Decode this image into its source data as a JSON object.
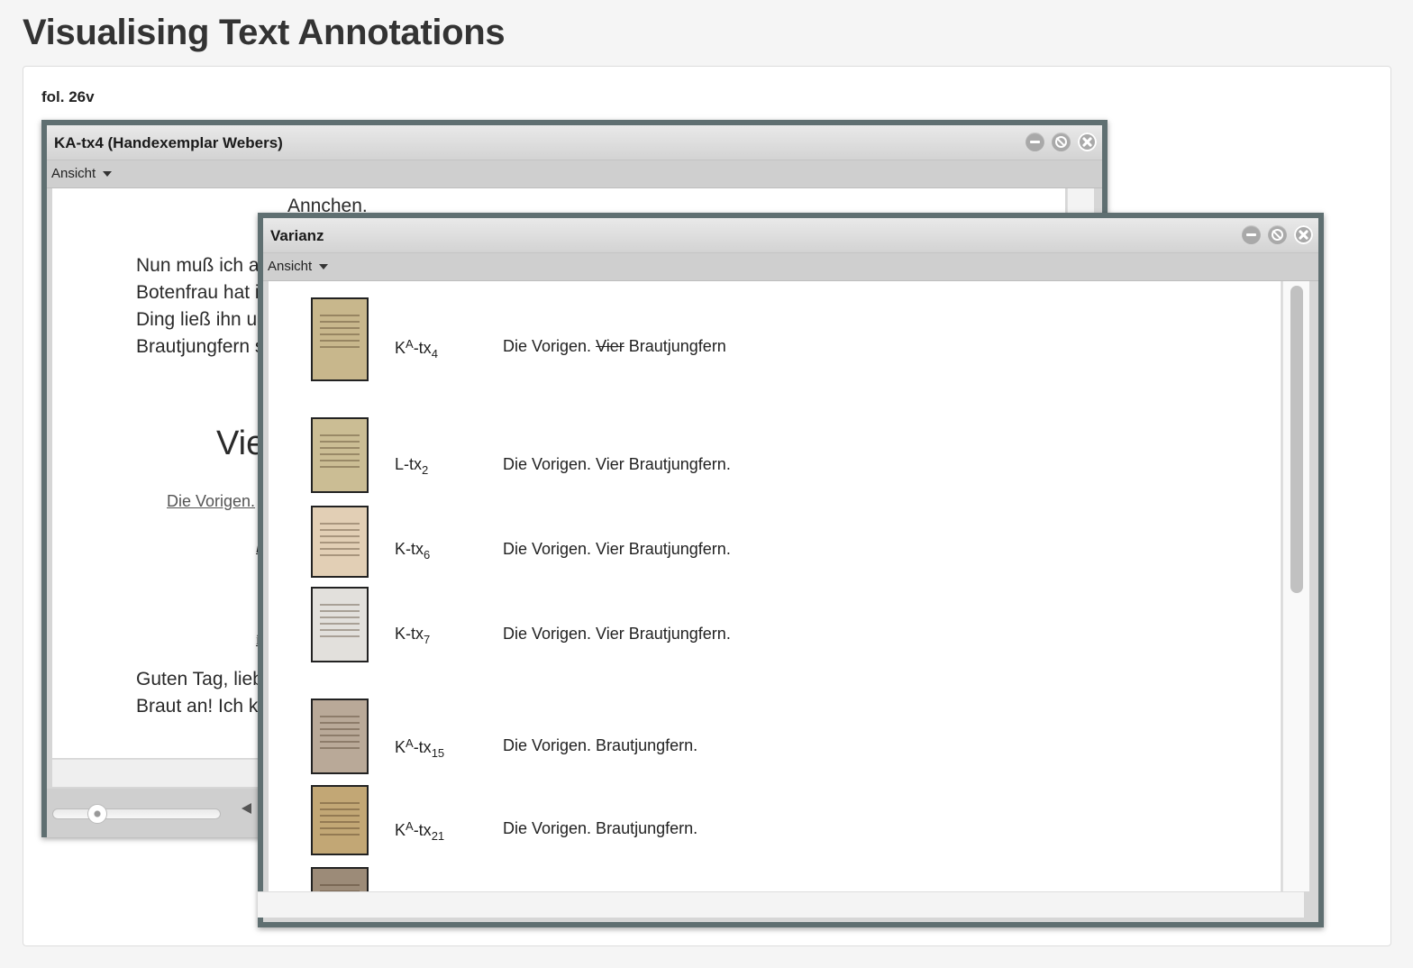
{
  "page": {
    "title": "Visualising Text Annotations",
    "folio": "fol. 26v"
  },
  "window_source": {
    "title": "KA-tx4 (Handexemplar Webers)",
    "menu_label": "Ansicht",
    "text": {
      "heading_name": "Annchen",
      "heading_punct": ".",
      "lines1": [
        "Nun muß ich al",
        "Botenfrau hat i",
        "Ding ließ ihn ur",
        "Brautjungfern s"
      ],
      "big_heading": "Vie",
      "stage_direction": "Die Vorigen.",
      "fragment_m": "M",
      "fragment_in": "in",
      "lines2": [
        "Guten Tag, lieb",
        "Braut an! Ich ke"
      ]
    },
    "zoom_level": 0.2
  },
  "window_varianz": {
    "title": "Varianz",
    "menu_label": "Ansicht",
    "rows": [
      {
        "base": "K",
        "sup": "A",
        "mid": "-tx",
        "sub": "4",
        "reading_before": "Die Vorigen. ",
        "reading_struck": "Vier",
        "reading_after": " Brautjungfern",
        "thumb_color": "#c8b78c"
      },
      {
        "base": "L",
        "sup": "",
        "mid": "-tx",
        "sub": "2",
        "reading_before": "Die Vorigen. Vier Brautjungfern.",
        "reading_struck": "",
        "reading_after": "",
        "thumb_color": "#cbbd94"
      },
      {
        "base": "K",
        "sup": "",
        "mid": "-tx",
        "sub": "6",
        "reading_before": "Die Vorigen. Vier Brautjungfern.",
        "reading_struck": "",
        "reading_after": "",
        "thumb_color": "#e2cfb5"
      },
      {
        "base": "K",
        "sup": "",
        "mid": "-tx",
        "sub": "7",
        "reading_before": "Die Vorigen. Vier Brautjungfern.",
        "reading_struck": "",
        "reading_after": "",
        "thumb_color": "#e2e0dc"
      },
      {
        "base": "K",
        "sup": "A",
        "mid": "-tx",
        "sub": "15",
        "reading_before": "Die Vorigen. Brautjungfern.",
        "reading_struck": "",
        "reading_after": "",
        "thumb_color": "#b9a998"
      },
      {
        "base": "K",
        "sup": "A",
        "mid": "-tx",
        "sub": "21",
        "reading_before": "Die Vorigen. Brautjungfern.",
        "reading_struck": "",
        "reading_after": "",
        "thumb_color": "#c2a775"
      },
      {
        "base": "",
        "sup": "",
        "mid": "",
        "sub": "",
        "reading_before": "",
        "reading_struck": "",
        "reading_after": "",
        "thumb_color": "#9c8b78"
      }
    ]
  }
}
